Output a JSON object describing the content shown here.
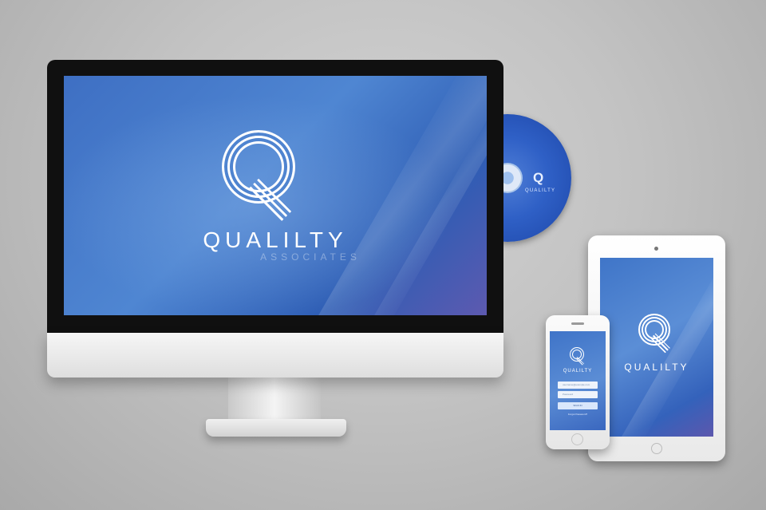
{
  "brand": {
    "name": "QUALILTY",
    "tagline": "ASSOCIATES",
    "logo_letter": "Q",
    "colors": {
      "screen_blue": "#4f86d2",
      "deep_blue": "#2e5db4",
      "white": "#ffffff"
    }
  },
  "cd": {
    "label": "QUALILTY"
  },
  "iphone": {
    "login": {
      "username_placeholder": "username@example.com",
      "password_placeholder": "Password",
      "sign_in_label": "SIGN IN",
      "forgot_label": "Forgot Password?"
    }
  }
}
